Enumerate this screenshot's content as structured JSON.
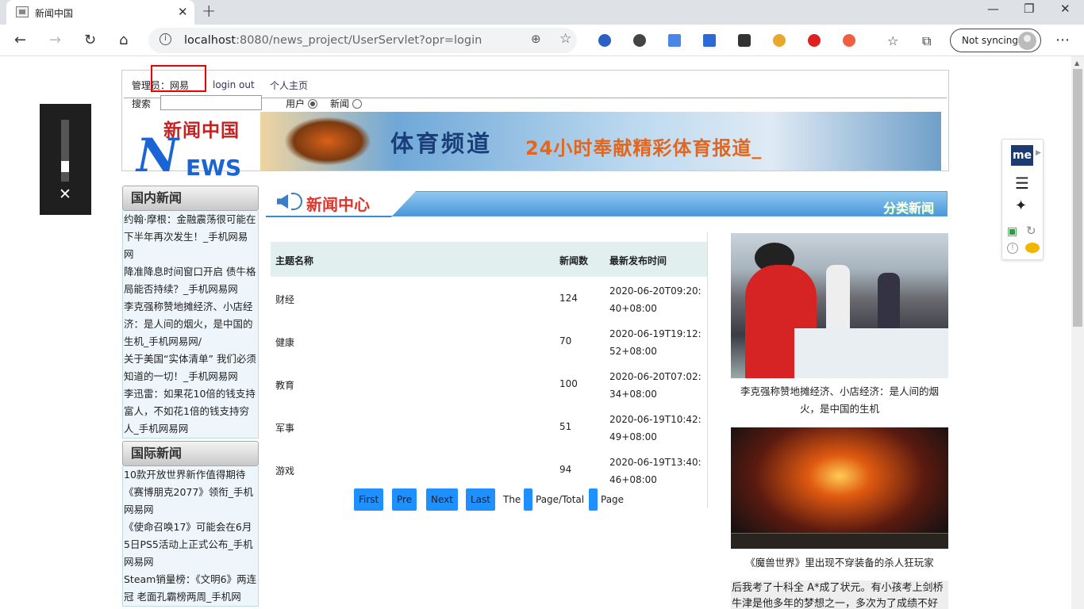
{
  "browser": {
    "tab_title": "新闻中国",
    "url_host": "localhost",
    "url_rest": ":8080/news_project/UserServlet?opr=login",
    "sync_label": "Not syncing"
  },
  "header": {
    "admin_label": "管理员：网易",
    "logout": "login out",
    "home": "个人主页",
    "search_label": "搜索",
    "search_value": "",
    "radio_user": "用户",
    "radio_news": "新闻",
    "logo_cn": "新闻中国",
    "logo_n": "N",
    "logo_ews": "EWS",
    "banner_title": "体育频道",
    "banner_sub": "24小时奉献精彩体育报道_"
  },
  "sidebar": {
    "domestic_title": "国内新闻",
    "domestic": [
      "约翰·摩根：金融震荡很可能在下半年再次发生！_手机网易网",
      "降准降息时间窗口开启 债牛格局能否持续？_手机网易网",
      "李克强称赞地摊经济、小店经济：是人间的烟火，是中国的生机_手机网易网/",
      "关于美国“实体清单” 我们必须知道的一切！_手机网易网",
      "李迅雷：如果花10倍的钱支持富人，不如花1倍的钱支持穷人_手机网易网"
    ],
    "intl_title": "国际新闻",
    "intl": [
      "10款开放世界新作值得期待 《赛博朋克2077》领衔_手机网易网",
      "《使命召唤17》可能会在6月5日PS5活动上正式公布_手机网易网",
      "Steam销量榜：《文明6》两连冠 老面孔霸榜两周_手机网"
    ]
  },
  "main": {
    "section_title": "新闻中心",
    "section_right": "分类新闻",
    "columns": [
      "主题名称",
      "新闻数",
      "最新发布时间"
    ],
    "rows": [
      {
        "name": "财经",
        "count": "124",
        "time": "2020-06-20T09:20:40+08:00"
      },
      {
        "name": "健康",
        "count": "70",
        "time": "2020-06-19T19:12:52+08:00"
      },
      {
        "name": "教育",
        "count": "100",
        "time": "2020-06-20T07:02:34+08:00"
      },
      {
        "name": "军事",
        "count": "51",
        "time": "2020-06-19T10:42:49+08:00"
      },
      {
        "name": "游戏",
        "count": "94",
        "time": "2020-06-19T13:40:46+08:00"
      }
    ],
    "pager": {
      "first": "First",
      "pre": "Pre",
      "next": "Next",
      "last": "Last",
      "the": "The",
      "page_total": "Page/Total",
      "page": "Page"
    }
  },
  "right": {
    "caption1": "李克强称赞地摊经济、小店经济：是人间的烟火，是中国的生机",
    "caption2": "《魔兽世界》里出现不穿装备的杀人狂玩家",
    "caption3": "后我考了十科全 A*成了状元。有小孩考上剑桥牛津是他多年的梦想之一，多次为了成绩不好"
  },
  "extension": {
    "me_label": "me"
  },
  "volume_level": 0.35
}
